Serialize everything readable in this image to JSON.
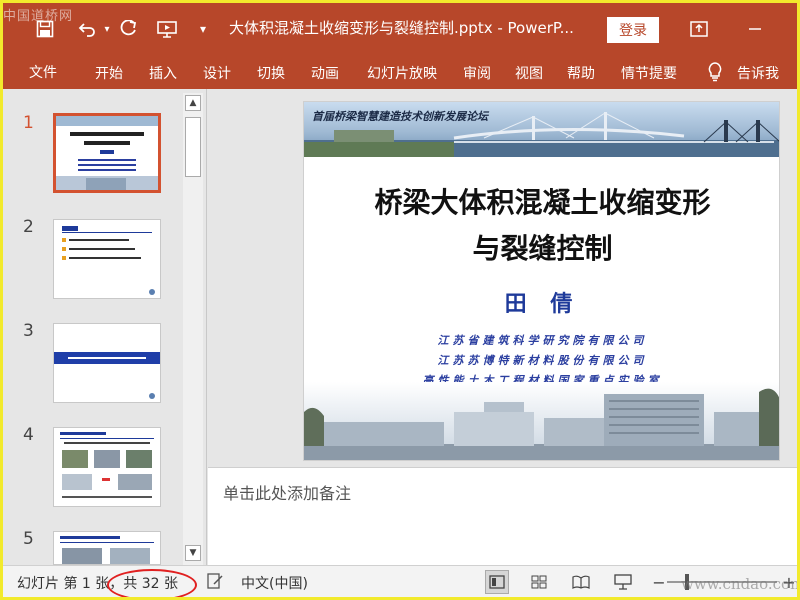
{
  "window": {
    "doc_title": "大体积混凝土收缩变形与裂缝控制.pptx - PowerP...",
    "login_label": "登录",
    "watermark_top": "中国道桥网"
  },
  "quick_access": {
    "icons": [
      "save-icon",
      "undo-icon",
      "redo-icon",
      "present-from-start-icon",
      "customize-dropdown-icon"
    ]
  },
  "ribbon": {
    "tabs": [
      "文件",
      "开始",
      "插入",
      "设计",
      "切换",
      "动画",
      "幻灯片放映",
      "审阅",
      "视图",
      "帮助",
      "情节提要"
    ],
    "tell_me": "告诉我"
  },
  "thumbnails": {
    "numbers": [
      "1",
      "2",
      "3",
      "4",
      "5"
    ],
    "selected": 1
  },
  "slide": {
    "banner": "首届桥梁智慧建造技术创新发展论坛",
    "title_line1": "桥梁大体积混凝土收缩变形",
    "title_line2": "与裂缝控制",
    "author": "田 倩",
    "affiliations": [
      "江苏省建筑科学研究院有限公司",
      "江苏苏博特新材料股份有限公司",
      "高性能土木工程材料国家重点实验室"
    ]
  },
  "notes": {
    "placeholder": "单击此处添加备注"
  },
  "status": {
    "slide_info": "幻灯片 第 1 张，共 32 张",
    "language": "中文(中国)",
    "watermark_bottom": "www.cndao.com"
  },
  "colors": {
    "ribbon": "#b7472a",
    "selection": "#d35230",
    "author": "#1e3a9a",
    "annotation_circle": "#e02020"
  }
}
